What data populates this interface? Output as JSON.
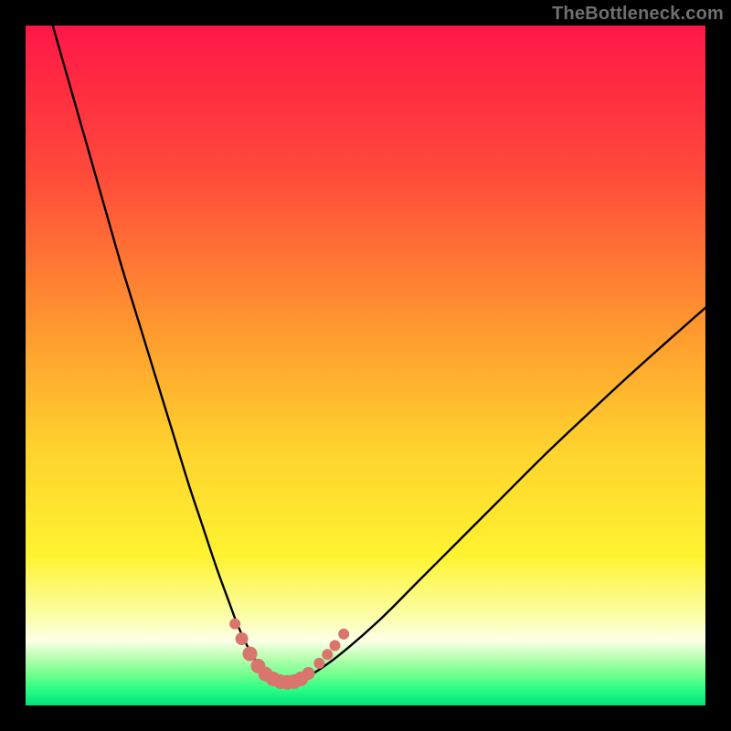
{
  "watermark": "TheBottleneck.com",
  "chart_data": {
    "type": "line",
    "title": "",
    "xlabel": "",
    "ylabel": "",
    "xlim": [
      0,
      100
    ],
    "ylim": [
      0,
      100
    ],
    "gradient_stops": [
      {
        "offset": 0,
        "color": "#ff1747"
      },
      {
        "offset": 0.22,
        "color": "#ff4b3a"
      },
      {
        "offset": 0.45,
        "color": "#ff9a2f"
      },
      {
        "offset": 0.62,
        "color": "#ffd22e"
      },
      {
        "offset": 0.78,
        "color": "#fff330"
      },
      {
        "offset": 0.87,
        "color": "#fbffab"
      },
      {
        "offset": 0.905,
        "color": "#fdffe8"
      },
      {
        "offset": 0.93,
        "color": "#b8ffb0"
      },
      {
        "offset": 0.955,
        "color": "#71ff8e"
      },
      {
        "offset": 0.975,
        "color": "#2dff85"
      },
      {
        "offset": 1.0,
        "color": "#00e27a"
      }
    ],
    "series": [
      {
        "name": "bottleneck-curve",
        "x": [
          4,
          6,
          8,
          10,
          12,
          14,
          16,
          18,
          20,
          22,
          24,
          26,
          28,
          30,
          31,
          32,
          33,
          34,
          35,
          36,
          37,
          38,
          39,
          40,
          42,
          46,
          52,
          58,
          64,
          70,
          76,
          82,
          88,
          94,
          100
        ],
        "y": [
          100,
          93,
          86,
          79,
          72,
          65,
          58.5,
          52,
          45.5,
          39,
          32.5,
          26.5,
          20.5,
          15,
          12.3,
          10,
          8,
          6.3,
          5.0,
          4.1,
          3.6,
          3.4,
          3.4,
          3.6,
          4.5,
          7.3,
          12.5,
          18.5,
          24.5,
          30.5,
          36.5,
          42.2,
          47.8,
          53.2,
          58.5
        ]
      }
    ],
    "marker_series": {
      "name": "bottom-markers",
      "color": "#d9756d",
      "points": [
        {
          "x": 30.8,
          "y": 12.0,
          "r": 6
        },
        {
          "x": 31.8,
          "y": 9.8,
          "r": 7
        },
        {
          "x": 33.0,
          "y": 7.6,
          "r": 8
        },
        {
          "x": 34.2,
          "y": 5.8,
          "r": 8
        },
        {
          "x": 35.3,
          "y": 4.6,
          "r": 8
        },
        {
          "x": 36.4,
          "y": 3.9,
          "r": 8
        },
        {
          "x": 37.5,
          "y": 3.5,
          "r": 8
        },
        {
          "x": 38.5,
          "y": 3.4,
          "r": 8
        },
        {
          "x": 39.5,
          "y": 3.5,
          "r": 8
        },
        {
          "x": 40.5,
          "y": 3.9,
          "r": 8
        },
        {
          "x": 41.6,
          "y": 4.7,
          "r": 7
        },
        {
          "x": 43.2,
          "y": 6.2,
          "r": 6
        },
        {
          "x": 44.4,
          "y": 7.5,
          "r": 6
        },
        {
          "x": 45.5,
          "y": 8.8,
          "r": 6
        },
        {
          "x": 46.8,
          "y": 10.5,
          "r": 6
        }
      ]
    }
  }
}
